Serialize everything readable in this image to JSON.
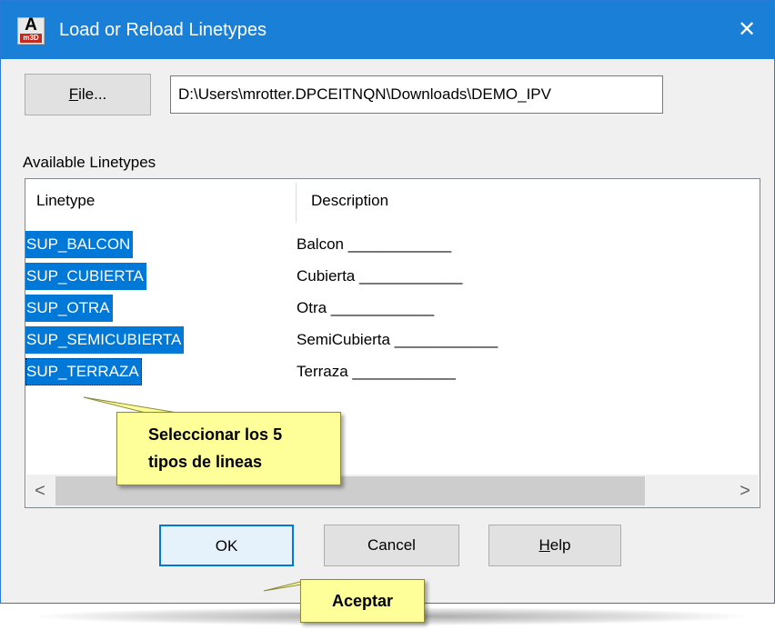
{
  "window": {
    "title": "Load or Reload Linetypes",
    "close_glyph": "✕",
    "app_icon_letter": "A",
    "app_icon_badge": "m3D",
    "titlebar_color": "#1a7fd6"
  },
  "file_button": {
    "label_accel": "F",
    "label_rest": "ile..."
  },
  "path_field": {
    "value": "D:\\Users\\mrotter.DPCEITNQN\\Downloads\\DEMO_IPV"
  },
  "available_label": "Available Linetypes",
  "list": {
    "headers": [
      "Linetype",
      "Description"
    ],
    "rows": [
      {
        "name": "SUP_BALCON",
        "description": "Balcon ____________"
      },
      {
        "name": "SUP_CUBIERTA",
        "description": "Cubierta ____________"
      },
      {
        "name": "SUP_OTRA",
        "description": "Otra ____________"
      },
      {
        "name": "SUP_SEMICUBIERTA",
        "description": "SemiCubierta ____________"
      },
      {
        "name": "SUP_TERRAZA",
        "description": "Terraza ____________"
      }
    ],
    "selection_color": "#0078d7"
  },
  "scrollbar": {
    "left_arrow": "<",
    "right_arrow": ">"
  },
  "callout_list": {
    "line1": "Seleccionar  los  5",
    "line2": "tipos de lineas"
  },
  "callout_ok": {
    "text": "Aceptar"
  },
  "buttons": {
    "ok": "OK",
    "cancel": "Cancel",
    "help_accel": "H",
    "help_rest": "elp"
  }
}
